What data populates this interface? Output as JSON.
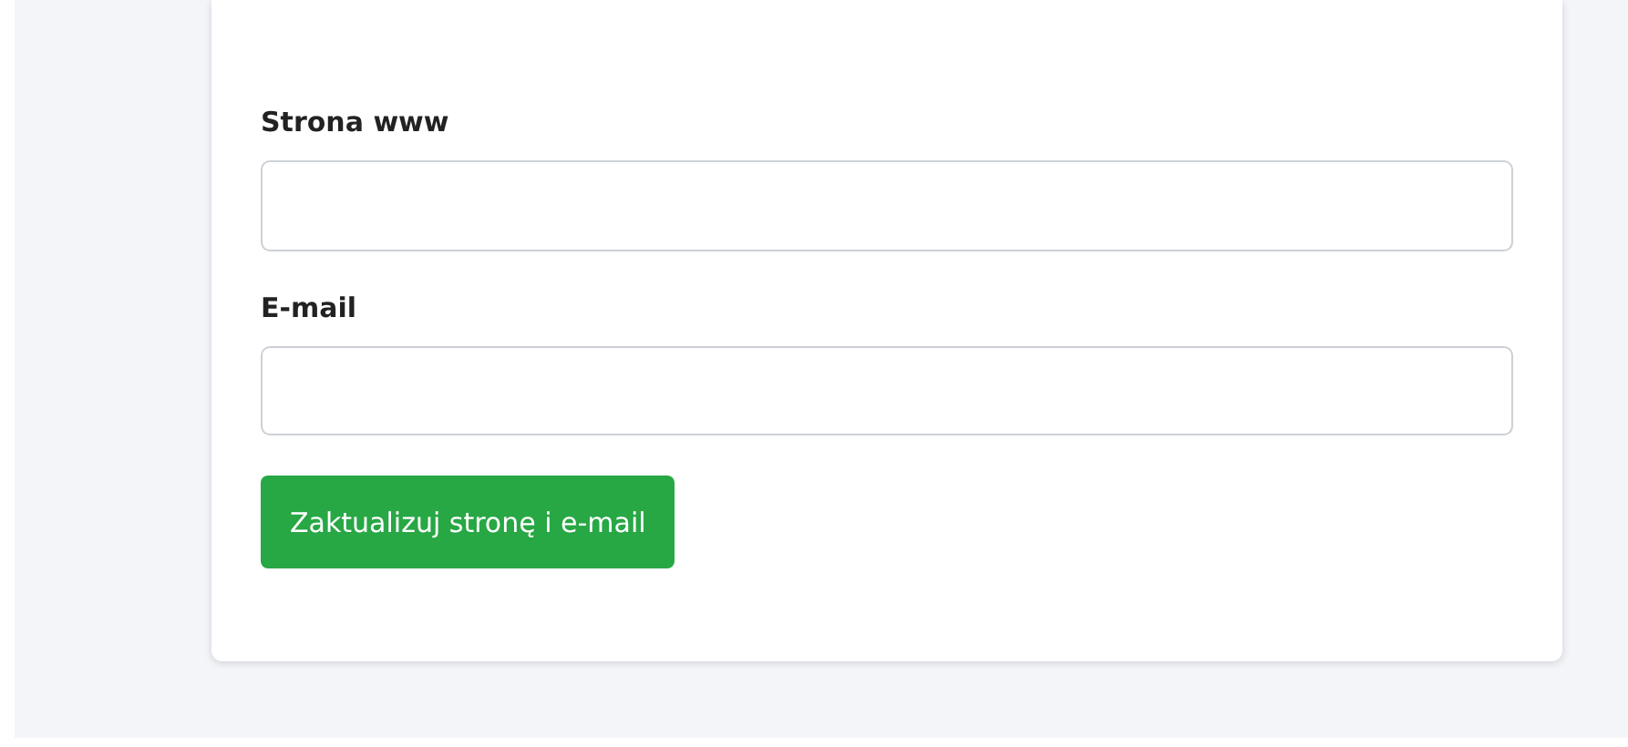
{
  "form": {
    "fields": [
      {
        "label": "Strona www"
      },
      {
        "label": "E-mail"
      }
    ],
    "submit_button": "Zaktualizuj stronę i e-mail"
  }
}
